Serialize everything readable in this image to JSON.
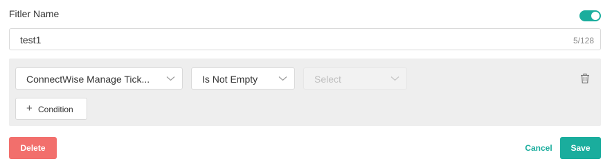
{
  "filter": {
    "name_label": "Fitler Name",
    "enabled": true,
    "name_value": "test1",
    "char_count": "5/128"
  },
  "condition": {
    "field_value": "ConnectWise Manage Tick...",
    "operator_value": "Is Not Empty",
    "value_placeholder": "Select"
  },
  "add_condition": {
    "plus": "+",
    "label": "Condition"
  },
  "actions": {
    "delete_label": "Delete",
    "cancel_label": "Cancel",
    "save_label": "Save"
  },
  "colors": {
    "accent": "#1aad9d",
    "danger": "#f26f6c",
    "panel_bg": "#eeeeee"
  },
  "icons": {
    "toggle": "toggle-switch",
    "chevron": "chevron-down-icon",
    "delete_condition": "trash-icon",
    "add": "plus-icon"
  }
}
